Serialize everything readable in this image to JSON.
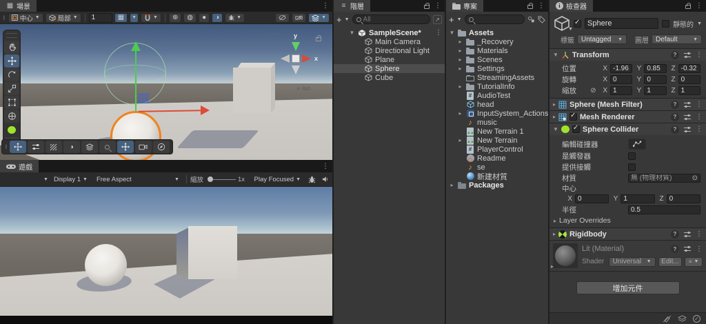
{
  "scene_panel": {
    "tab": "場景",
    "toolbar": {
      "pivot_label": "中心",
      "orientation_label": "局部",
      "tool_size": "1",
      "icons": [
        "grid-visibility-icon",
        "snap-icon",
        "shading-mode-icon",
        "debug-shading-icon",
        "lighting-icon",
        "effects-icon",
        "bug-icon",
        "scene-visibility-icon",
        "camera-cull-icon",
        "layers-icon"
      ]
    },
    "viewport": {
      "gizmo_axis_x": "x",
      "gizmo_axis_y": "y",
      "projection_label": "Iso",
      "overlay_tools": [
        "view-tool",
        "move-tool",
        "rotate-tool",
        "scale-tool",
        "rect-tool",
        "transform-tool",
        "sphere-collider-tool",
        "edit-collider-tool"
      ]
    }
  },
  "game_panel": {
    "tab": "遊戲",
    "toolbar": {
      "display": "Display 1",
      "aspect": "Free Aspect",
      "zoom_label": "縮放",
      "zoom_value": "1x",
      "play_mode": "Play Focused",
      "icons": [
        "bug-icon",
        "speaker-icon"
      ]
    }
  },
  "hierarchy": {
    "tab": "階層",
    "search_placeholder": "All",
    "scene_name": "SampleScene*",
    "items": [
      {
        "label": "Main Camera",
        "icon": "gameobject-icon"
      },
      {
        "label": "Directional Light",
        "icon": "gameobject-icon"
      },
      {
        "label": "Plane",
        "icon": "gameobject-icon"
      },
      {
        "label": "Sphere",
        "icon": "gameobject-icon",
        "selected": true
      },
      {
        "label": "Cube",
        "icon": "gameobject-icon"
      }
    ]
  },
  "project": {
    "tab": "專案",
    "root_label": "Assets",
    "items": [
      {
        "label": "_Recovery",
        "icon": "folder-icon",
        "expandable": true
      },
      {
        "label": "Materials",
        "icon": "folder-icon",
        "expandable": true
      },
      {
        "label": "Scenes",
        "icon": "folder-icon",
        "expandable": true
      },
      {
        "label": "Settings",
        "icon": "folder-icon",
        "expandable": true
      },
      {
        "label": "StreamingAssets",
        "icon": "folder-empty-icon",
        "expandable": false
      },
      {
        "label": "TutorialInfo",
        "icon": "folder-icon",
        "expandable": true
      },
      {
        "label": "AudioTest",
        "icon": "script-icon",
        "expandable": false
      },
      {
        "label": "head",
        "icon": "prefab-icon",
        "expandable": false
      },
      {
        "label": "InputSystem_Actions",
        "icon": "input-actions-icon",
        "expandable": true
      },
      {
        "label": "music",
        "icon": "audio-icon",
        "expandable": false
      },
      {
        "label": "New Terrain 1",
        "icon": "terrain-icon",
        "expandable": false
      },
      {
        "label": "New Terrain",
        "icon": "terrain-icon",
        "expandable": true
      },
      {
        "label": "PlayerControl",
        "icon": "script-icon",
        "expandable": false
      },
      {
        "label": "Readme",
        "icon": "readme-icon",
        "expandable": false
      },
      {
        "label": "se",
        "icon": "audio-icon",
        "expandable": false
      },
      {
        "label": "新建材質",
        "icon": "material-icon",
        "expandable": false
      }
    ],
    "packages_label": "Packages"
  },
  "inspector": {
    "tab": "檢查器",
    "header": {
      "name": "Sphere",
      "static_label": "靜態的",
      "tag_label": "標籤",
      "tag_value": "Untagged",
      "layer_label": "圖層",
      "layer_value": "Default"
    },
    "transform": {
      "title": "Transform",
      "position_label": "位置",
      "rotation_label": "旋轉",
      "scale_label": "縮放",
      "axis_x": "X",
      "axis_y": "Y",
      "axis_z": "Z",
      "position": {
        "x": "-1.96",
        "y": "0.85",
        "z": "-0.32"
      },
      "rotation": {
        "x": "0",
        "y": "0",
        "z": "0"
      },
      "scale": {
        "x": "1",
        "y": "1",
        "z": "1"
      }
    },
    "mesh_filter": {
      "title": "Sphere (Mesh Filter)"
    },
    "mesh_renderer": {
      "title": "Mesh Renderer"
    },
    "sphere_collider": {
      "title": "Sphere Collider",
      "edit_collider_label": "編輯碰撞器",
      "is_trigger_label": "是觸發器",
      "provides_contacts_label": "提供接觸",
      "material_label": "材質",
      "material_value": "無 (物理材質)",
      "center_label": "中心",
      "axis_x": "X",
      "axis_y": "Y",
      "axis_z": "Z",
      "center": {
        "x": "0",
        "y": "1",
        "z": "0"
      },
      "radius_label": "半徑",
      "radius_value": "0.5",
      "layer_overrides_label": "Layer Overrides"
    },
    "rigidbody": {
      "title": "Rigidbody"
    },
    "material": {
      "name": "Lit (Material)",
      "shader_label": "Shader",
      "shader_dropdown": "Universal R",
      "edit_button": "Edit..."
    },
    "add_component_label": "增加元件"
  }
}
